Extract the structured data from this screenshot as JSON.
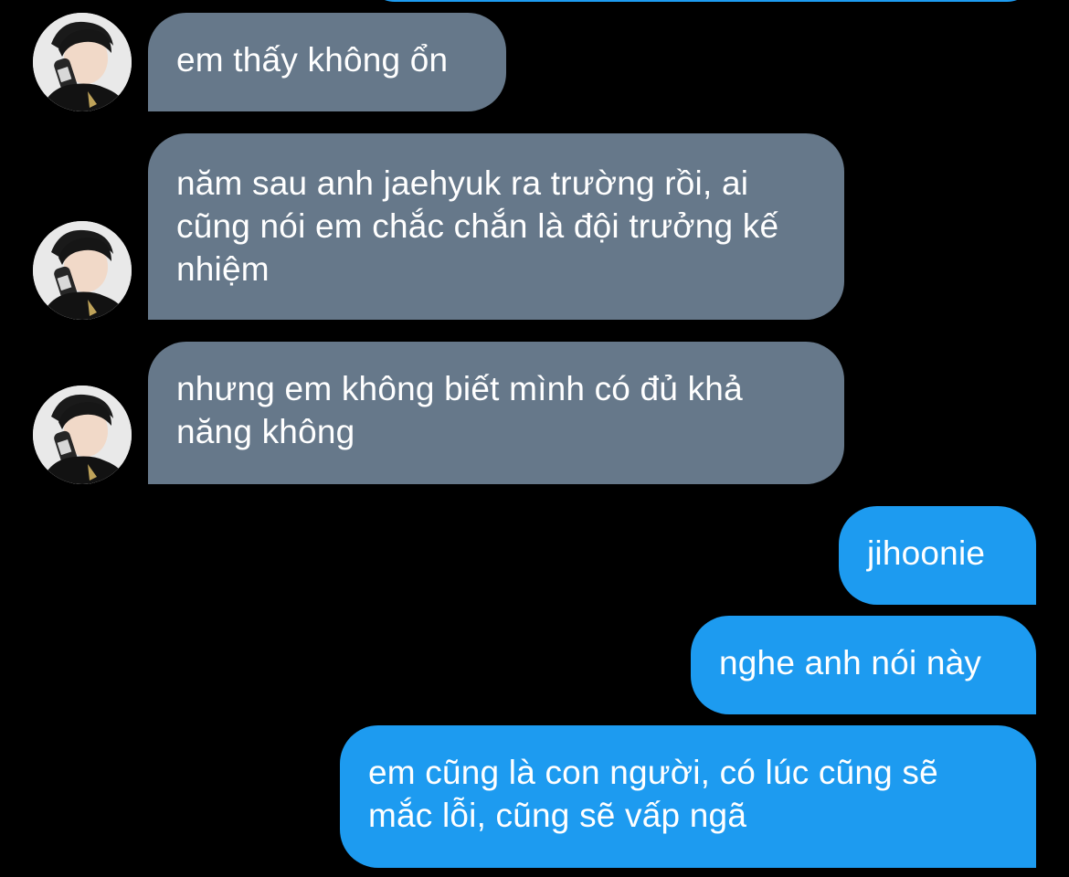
{
  "colors": {
    "background": "#000000",
    "received_bubble": "#66788a",
    "sent_bubble": "#1d9bf0",
    "text": "#ffffff"
  },
  "conversation": {
    "messages": [
      {
        "direction": "received",
        "text": "em thấy không ổn",
        "has_avatar": true
      },
      {
        "direction": "received",
        "text": "năm sau anh jaehyuk ra trường rồi, ai cũng nói em chắc chắn là đội trưởng kế nhiệm",
        "has_avatar": true
      },
      {
        "direction": "received",
        "text": "nhưng em không biết mình có đủ khả năng không",
        "has_avatar": true
      },
      {
        "direction": "sent",
        "text": "jihoonie"
      },
      {
        "direction": "sent",
        "text": "nghe anh nói này"
      },
      {
        "direction": "sent",
        "text": "em cũng là con người, có lúc cũng sẽ mắc lỗi, cũng sẽ vấp ngã"
      }
    ]
  }
}
